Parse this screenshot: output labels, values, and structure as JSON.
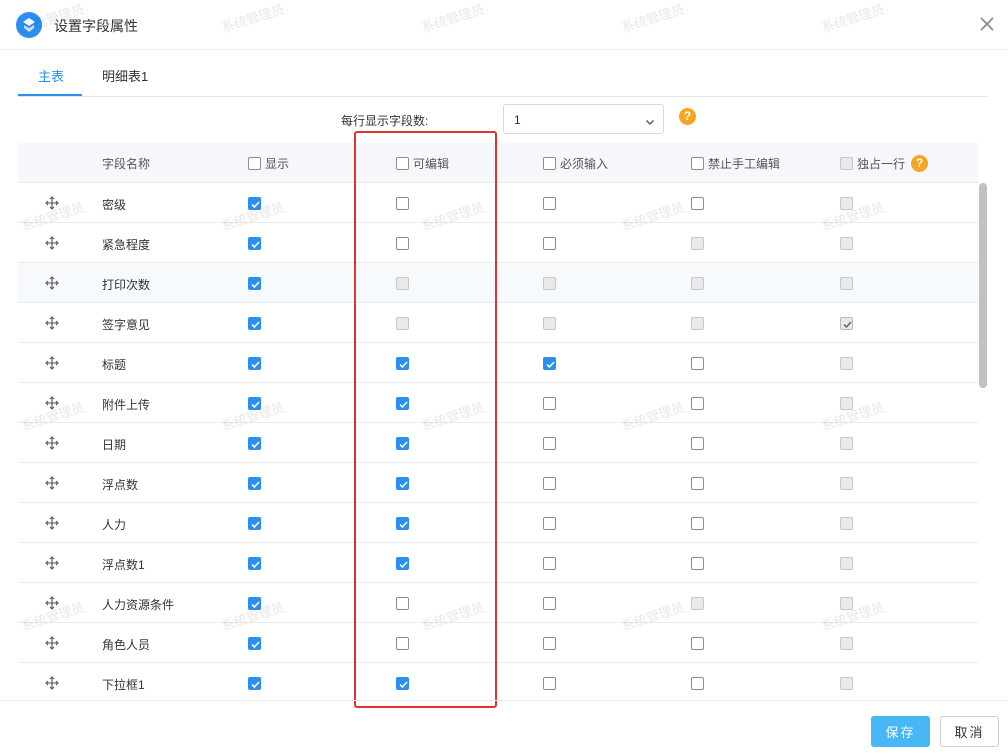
{
  "dialog": {
    "title": "设置字段属性",
    "tabs": [
      {
        "label": "主表",
        "active": true
      },
      {
        "label": "明细表1",
        "active": false
      }
    ],
    "fields_per_row": {
      "label": "每行显示字段数:",
      "value": "1"
    },
    "columns": {
      "name": "字段名称",
      "show": "显示",
      "editable": "可编辑",
      "required": "必须输入",
      "no_manual_edit": "禁止手工编辑",
      "full_row": "独占一行"
    },
    "rows": [
      {
        "name": "密级",
        "show": "on",
        "editable": "off",
        "required": "off",
        "no_manual_edit": "off",
        "full_row": "dis"
      },
      {
        "name": "紧急程度",
        "show": "on",
        "editable": "off",
        "required": "off",
        "no_manual_edit": "dis",
        "full_row": "dis"
      },
      {
        "name": "打印次数",
        "show": "on",
        "editable": "dis",
        "required": "dis",
        "no_manual_edit": "dis",
        "full_row": "dis"
      },
      {
        "name": "签字意见",
        "show": "on",
        "editable": "dis",
        "required": "dis",
        "no_manual_edit": "dis",
        "full_row": "dison"
      },
      {
        "name": "标题",
        "show": "on",
        "editable": "on",
        "required": "on",
        "no_manual_edit": "off",
        "full_row": "dis"
      },
      {
        "name": "附件上传",
        "show": "on",
        "editable": "on",
        "required": "off",
        "no_manual_edit": "off",
        "full_row": "dis"
      },
      {
        "name": "日期",
        "show": "on",
        "editable": "on",
        "required": "off",
        "no_manual_edit": "off",
        "full_row": "dis"
      },
      {
        "name": "浮点数",
        "show": "on",
        "editable": "on",
        "required": "off",
        "no_manual_edit": "off",
        "full_row": "dis"
      },
      {
        "name": "人力",
        "show": "on",
        "editable": "on",
        "required": "off",
        "no_manual_edit": "off",
        "full_row": "dis"
      },
      {
        "name": "浮点数1",
        "show": "on",
        "editable": "on",
        "required": "off",
        "no_manual_edit": "off",
        "full_row": "dis"
      },
      {
        "name": "人力资源条件",
        "show": "on",
        "editable": "off",
        "required": "off",
        "no_manual_edit": "dis",
        "full_row": "dis"
      },
      {
        "name": "角色人员",
        "show": "on",
        "editable": "off",
        "required": "off",
        "no_manual_edit": "off",
        "full_row": "dis"
      },
      {
        "name": "下拉框1",
        "show": "on",
        "editable": "on",
        "required": "off",
        "no_manual_edit": "off",
        "full_row": "dis"
      }
    ],
    "buttons": {
      "save": "保存",
      "cancel": "取消"
    },
    "watermark": "系统管理员",
    "colors": {
      "accent": "#2b8ff0",
      "save_button": "#47b8f5",
      "highlight": "#e0322e",
      "help": "#f5a623"
    }
  }
}
